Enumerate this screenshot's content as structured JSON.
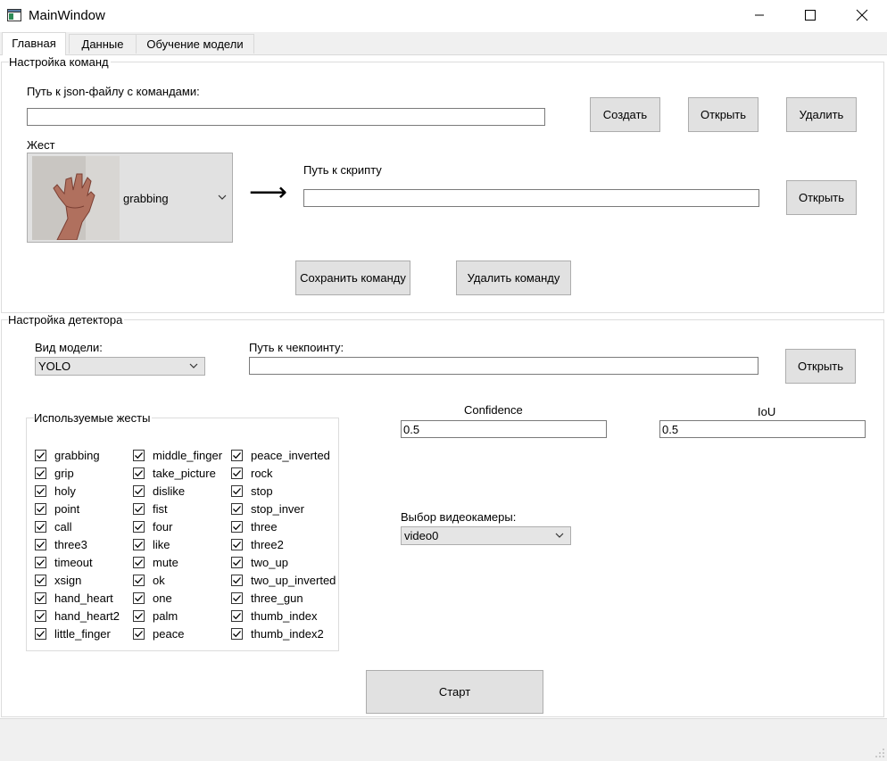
{
  "window": {
    "title": "MainWindow",
    "controls": [
      "minimize-icon",
      "maximize-icon",
      "close-icon"
    ]
  },
  "tabs": [
    {
      "label": "Главная",
      "active": true
    },
    {
      "label": "Данные",
      "active": false
    },
    {
      "label": "Обучение модели",
      "active": false
    }
  ],
  "commands": {
    "group_title": "Настройка команд",
    "json_path_label": "Путь к json-файлу с командами:",
    "json_path_value": "",
    "create_button": "Создать",
    "open_button": "Открыть",
    "delete_button": "Удалить",
    "gesture_label": "Жест",
    "gesture_value": "grabbing",
    "arrow": "⟶",
    "script_path_label": "Путь к скрипту",
    "script_path_value": "",
    "script_open_button": "Открыть",
    "save_command_button": "Сохранить команду",
    "delete_command_button": "Удалить команду"
  },
  "detector": {
    "group_title": "Настройка детектора",
    "model_type_label": "Вид модели:",
    "model_type_value": "YOLO",
    "checkpoint_label": "Путь к чекпоинту:",
    "checkpoint_value": "",
    "checkpoint_open_button": "Открыть",
    "gestures_group_title": "Используемые жесты",
    "gesture_columns": [
      [
        {
          "label": "grabbing",
          "checked": true
        },
        {
          "label": "grip",
          "checked": true
        },
        {
          "label": "holy",
          "checked": true
        },
        {
          "label": "point",
          "checked": true
        },
        {
          "label": "call",
          "checked": true
        },
        {
          "label": "three3",
          "checked": true
        },
        {
          "label": "timeout",
          "checked": true
        },
        {
          "label": "xsign",
          "checked": true
        },
        {
          "label": "hand_heart",
          "checked": true
        },
        {
          "label": "hand_heart2",
          "checked": true
        },
        {
          "label": "little_finger",
          "checked": true
        }
      ],
      [
        {
          "label": "middle_finger",
          "checked": true
        },
        {
          "label": "take_picture",
          "checked": true
        },
        {
          "label": "dislike",
          "checked": true
        },
        {
          "label": "fist",
          "checked": true
        },
        {
          "label": "four",
          "checked": true
        },
        {
          "label": "like",
          "checked": true
        },
        {
          "label": "mute",
          "checked": true
        },
        {
          "label": "ok",
          "checked": true
        },
        {
          "label": "one",
          "checked": true
        },
        {
          "label": "palm",
          "checked": true
        },
        {
          "label": "peace",
          "checked": true
        }
      ],
      [
        {
          "label": "peace_inverted",
          "checked": true
        },
        {
          "label": "rock",
          "checked": true
        },
        {
          "label": "stop",
          "checked": true
        },
        {
          "label": "stop_inver",
          "checked": true
        },
        {
          "label": "three",
          "checked": true
        },
        {
          "label": "three2",
          "checked": true
        },
        {
          "label": "two_up",
          "checked": true
        },
        {
          "label": "two_up_inverted",
          "checked": true
        },
        {
          "label": "three_gun",
          "checked": true
        },
        {
          "label": "thumb_index",
          "checked": true
        },
        {
          "label": "thumb_index2",
          "checked": true
        }
      ]
    ],
    "confidence_label": "Confidence",
    "confidence_value": "0.5",
    "iou_label": "IoU",
    "iou_value": "0.5",
    "camera_label": "Выбор видеокамеры:",
    "camera_value": "video0",
    "start_button": "Старт"
  }
}
